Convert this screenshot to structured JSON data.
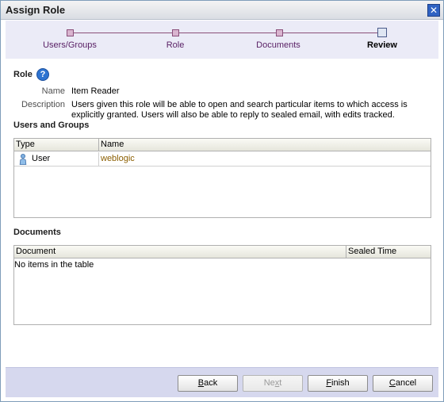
{
  "window": {
    "title": "Assign Role",
    "close_glyph": "✕"
  },
  "train": {
    "steps": [
      {
        "label": "Users/Groups",
        "state": "visited"
      },
      {
        "label": "Role",
        "state": "visited"
      },
      {
        "label": "Documents",
        "state": "visited"
      },
      {
        "label": "Review",
        "state": "current"
      }
    ]
  },
  "role": {
    "heading": "Role",
    "help_glyph": "?",
    "name_label": "Name",
    "name_value": "Item Reader",
    "description_label": "Description",
    "description_line1": "Users given this role will be able to open and search particular items to which access is",
    "description_line2": "explicitly granted. Users will also be able to reply to sealed email, with edits tracked."
  },
  "users_groups": {
    "heading": "Users and Groups",
    "columns": [
      "Type",
      "Name"
    ],
    "rows": [
      {
        "type": "User",
        "name": "weblogic",
        "icon": "user-icon"
      }
    ]
  },
  "documents": {
    "heading": "Documents",
    "columns": [
      "Document",
      "Sealed Time"
    ],
    "empty_text": "No items in the table"
  },
  "buttons": {
    "back": {
      "label": "Back",
      "accel": "B",
      "enabled": true
    },
    "next": {
      "label": "Next",
      "accel": "x",
      "enabled": false
    },
    "finish": {
      "label": "Finish",
      "accel": "F",
      "enabled": true
    },
    "cancel": {
      "label": "Cancel",
      "accel": "C",
      "enabled": true
    }
  },
  "colors": {
    "accent_link": "#8b5e00",
    "train_purple": "#5a2166",
    "footer_bg": "#d6d8ee"
  }
}
